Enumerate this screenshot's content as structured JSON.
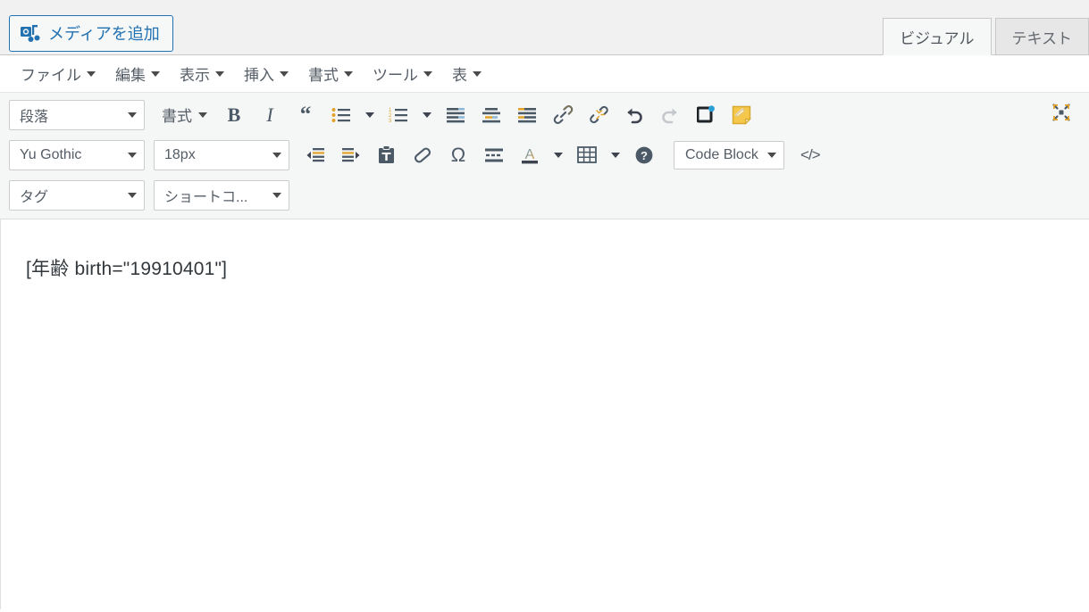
{
  "topbar": {
    "media_button_label": "メディアを追加",
    "media_icon": "media-add-icon",
    "tabs": [
      {
        "label": "ビジュアル",
        "name": "tab-visual",
        "active": true
      },
      {
        "label": "テキスト",
        "name": "tab-text",
        "active": false
      }
    ]
  },
  "menubar": {
    "items": [
      {
        "label": "ファイル",
        "name": "menu-file"
      },
      {
        "label": "編集",
        "name": "menu-edit"
      },
      {
        "label": "表示",
        "name": "menu-view"
      },
      {
        "label": "挿入",
        "name": "menu-insert"
      },
      {
        "label": "書式",
        "name": "menu-format"
      },
      {
        "label": "ツール",
        "name": "menu-tools"
      },
      {
        "label": "表",
        "name": "menu-table"
      }
    ]
  },
  "toolbar_row1": {
    "paragraph_select": "段落",
    "formats_label": "書式",
    "bold": "B",
    "italic": "I",
    "blockquote": "“",
    "bullet_list_icon": "bullet-list-icon",
    "numbered_list_icon": "numbered-list-icon",
    "align_left_icon": "align-left-icon",
    "align_center_icon": "align-center-icon",
    "align_right_icon": "align-right-icon",
    "link_icon": "insert-link-icon",
    "unlink_icon": "remove-link-icon",
    "undo_icon": "undo-icon",
    "redo_icon": "redo-icon",
    "toolbar_toggle_icon": "kitchen-sink-icon",
    "sticky_note_icon": "sticky-note-icon",
    "fullscreen_icon": "distraction-free-icon"
  },
  "toolbar_row2": {
    "font_family_select": "Yu Gothic",
    "font_size_select": "18px",
    "outdent_icon": "outdent-icon",
    "indent_icon": "indent-icon",
    "paste_as_text_icon": "paste-as-text-icon",
    "clear_formatting_icon": "eraser-icon",
    "special_character": "Ω",
    "horizontal_rule_icon": "horizontal-rule-icon",
    "text_color": "A",
    "text_color_icon": "text-color-icon",
    "table_icon": "table-icon",
    "help_icon": "help-icon",
    "code_block_select": "Code Block",
    "source_code_icon": "source-code-icon",
    "source_code_glyph": "</>"
  },
  "toolbar_row3": {
    "tag_select": "タグ",
    "shortcode_select": "ショートコ..."
  },
  "content": {
    "body_text": "[年齢 birth=\"19910401\"]"
  },
  "colors": {
    "accent_blue": "#2271b1",
    "toolbar_bg": "#f5f6f6",
    "topbar_bg": "#f1f1f1",
    "icon_gray": "#555d66",
    "icon_orange": "#e2a32b",
    "sticky_yellow": "#f5c84c",
    "navy": "#1d2327"
  }
}
